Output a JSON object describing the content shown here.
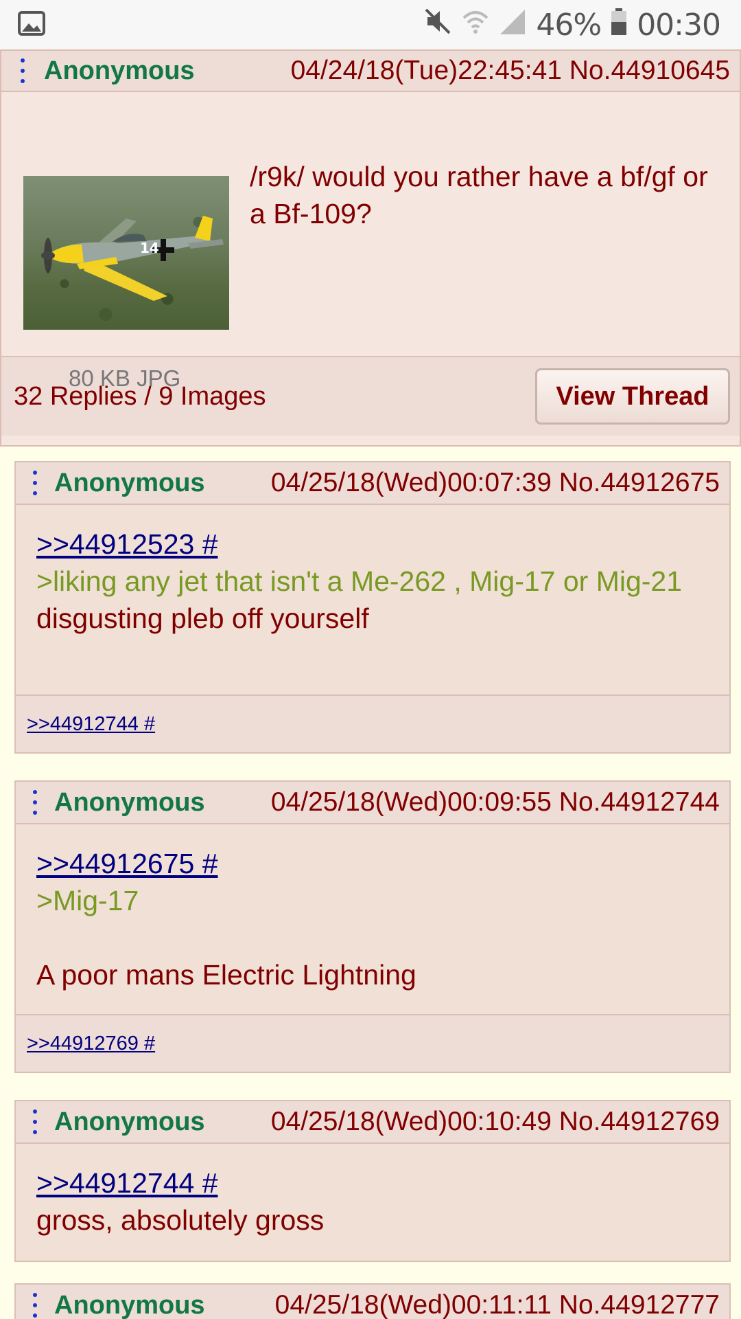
{
  "status_bar": {
    "battery": "46%",
    "time": "00:30",
    "icons": [
      "image-icon",
      "mute-icon",
      "wifi-icon",
      "signal-icon",
      "battery-icon"
    ]
  },
  "op": {
    "name": "Anonymous",
    "meta": "04/24/18(Tue)22:45:41 No.44910645",
    "subject": "/r9k/ would you rather have a bf/gf or a Bf-109?",
    "file_info": "80 KB JPG",
    "replies_summary": "32 Replies / 9 Images",
    "view_thread": "View Thread"
  },
  "replies": [
    {
      "name": "Anonymous",
      "meta": "04/25/18(Wed)00:07:39 No.44912675",
      "quote": ">>44912523 #",
      "greentext": ">liking any jet that isn't a Me-262 , Mig-17 or Mig-21",
      "text": "disgusting pleb off yourself",
      "backlink": ">>44912744 #"
    },
    {
      "name": "Anonymous",
      "meta": "04/25/18(Wed)00:09:55 No.44912744",
      "quote": ">>44912675 #",
      "greentext": ">Mig-17",
      "text": "A poor mans Electric Lightning",
      "backlink": ">>44912769 #"
    },
    {
      "name": "Anonymous",
      "meta": "04/25/18(Wed)00:10:49 No.44912769",
      "quote": ">>44912744 #",
      "text": "gross, absolutely gross"
    },
    {
      "name": "Anonymous",
      "meta": "04/25/18(Wed)00:11:11 No.44912777"
    }
  ],
  "colors": {
    "name": "#117743",
    "text": "#800000",
    "greentext": "#789922",
    "quotelink": "#000080",
    "reply_bg": "#f0e0d6",
    "page_bg": "#fffee9"
  }
}
